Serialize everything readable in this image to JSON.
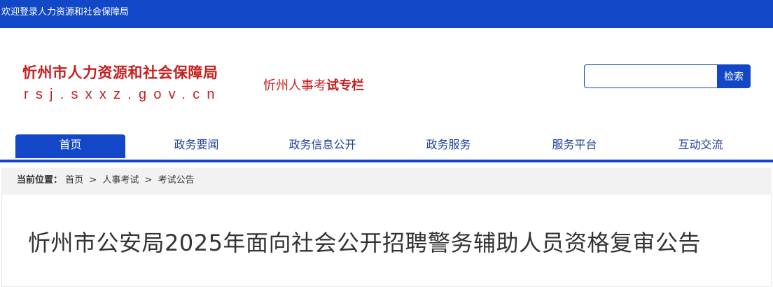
{
  "topbar": {
    "welcome": "欢迎登录人力资源和社会保障局"
  },
  "header": {
    "site_name": "忻州市人力资源和社会保障局",
    "site_url": "rsj.sxxz.gov.cn",
    "exam_link_prefix": "忻州人事考",
    "exam_link_emphasis": "试专栏",
    "brand_color": "#c81e1e"
  },
  "search": {
    "placeholder": "",
    "value": "",
    "button_label": "检索"
  },
  "nav": {
    "accent_color": "#1248c7",
    "items": [
      {
        "label": "首页",
        "active": true
      },
      {
        "label": "政务要闻",
        "active": false
      },
      {
        "label": "政务信息公开",
        "active": false
      },
      {
        "label": "政务服务",
        "active": false
      },
      {
        "label": "服务平台",
        "active": false
      },
      {
        "label": "互动交流",
        "active": false
      }
    ]
  },
  "breadcrumb": {
    "label": "当前位置：",
    "items": [
      "首页",
      "人事考试",
      "考试公告"
    ],
    "separator": ">"
  },
  "article": {
    "title": "忻州市公安局2025年面向社会公开招聘警务辅助人员资格复审公告"
  }
}
